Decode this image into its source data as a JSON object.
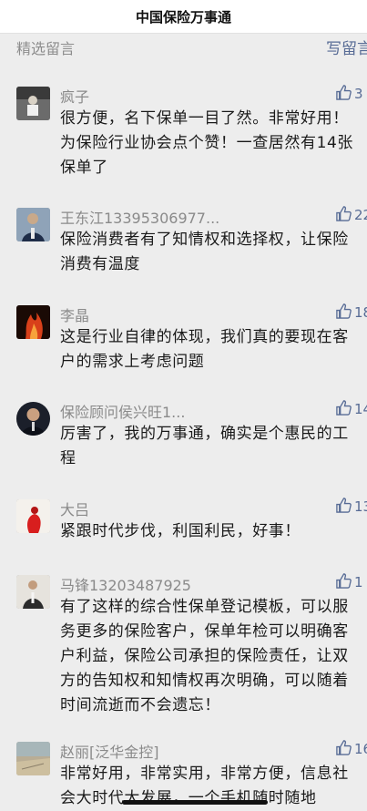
{
  "header": {
    "title": "中国保险万事通"
  },
  "section": {
    "title": "精选留言",
    "write_link": "写留言"
  },
  "comments": [
    {
      "name": "疯子",
      "likes": "3",
      "text": "很方便，名下保单一目了然。非常好用！为保险行业协会点个赞！一查居然有14张保单了"
    },
    {
      "name": "王东江13395306977...",
      "likes": "22",
      "text": "保险消费者有了知情权和选择权，让保险消费有温度"
    },
    {
      "name": "李晶",
      "likes": "18",
      "text": "这是行业自律的体现，我们真的要现在客户的需求上考虑问题"
    },
    {
      "name": "保险顾问侯兴旺1...",
      "likes": "14",
      "text": "厉害了，我的万事通，确实是个惠民的工程"
    },
    {
      "name": "大吕",
      "likes": "13",
      "text": "紧跟时代步伐，利国利民，好事！"
    },
    {
      "name": "马锋13203487925",
      "likes": "1",
      "text": "有了这样的综合性保单登记模板，可以服务更多的保险客户，保单年检可以明确客户利益，保险公司承担的保险责任，让双方的告知权和知情权再次明确，可以随着时间流逝而不会遗忘！"
    },
    {
      "name": "赵丽[泛华金控]",
      "likes": "16",
      "text": "非常好用，非常实用，非常方便，信息社会大时代大发展，一个手机随时随地"
    }
  ],
  "colors": {
    "link": "#576b95",
    "background": "#ededed"
  }
}
